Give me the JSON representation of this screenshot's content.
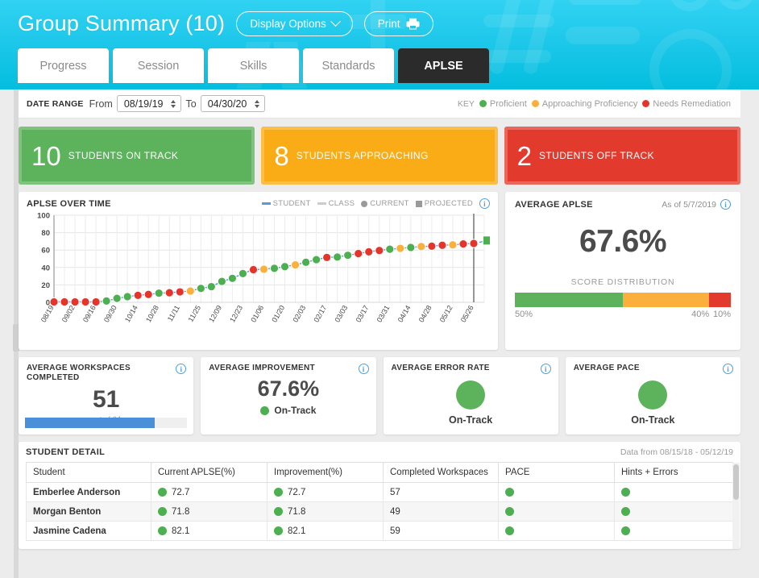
{
  "header": {
    "title": "Group Summary (10)",
    "display_options_label": "Display Options",
    "print_label": "Print",
    "tabs": [
      {
        "label": "Progress",
        "active": false
      },
      {
        "label": "Session",
        "active": false
      },
      {
        "label": "Skills",
        "active": false
      },
      {
        "label": "Standards",
        "active": false
      },
      {
        "label": "APLSE",
        "active": true
      }
    ]
  },
  "date_range": {
    "label": "DATE RANGE",
    "from_label": "From",
    "from_value": "08/19/19",
    "to_label": "To",
    "to_value": "04/30/20"
  },
  "key": {
    "label": "KEY",
    "items": [
      {
        "label": "Proficient",
        "color": "#4caf50"
      },
      {
        "label": "Approaching Proficiency",
        "color": "#fbb03b"
      },
      {
        "label": "Needs Remediation",
        "color": "#e5342a"
      }
    ]
  },
  "tiles": [
    {
      "value": "10",
      "caption": "STUDENTS ON TRACK",
      "color": "#5cb35c"
    },
    {
      "value": "8",
      "caption": "STUDENTS APPROACHING",
      "color": "#f9ac16"
    },
    {
      "value": "2",
      "caption": "STUDENTS OFF TRACK",
      "color": "#e23b2e"
    }
  ],
  "chart_card": {
    "title": "APLSE OVER TIME",
    "legend": [
      {
        "label": "STUDENT",
        "kind": "line",
        "color": "#5b9bd5"
      },
      {
        "label": "CLASS",
        "kind": "line",
        "color": "#cccccc"
      },
      {
        "label": "CURRENT",
        "kind": "circle",
        "color": "#9a9a9a"
      },
      {
        "label": "PROJECTED",
        "kind": "square",
        "color": "#9a9a9a"
      }
    ],
    "info_icon": "info-icon"
  },
  "average_aplse": {
    "title": "AVERAGE APLSE",
    "as_of": "As of 5/7/2019",
    "value": "67.6%",
    "distribution_label": "SCORE DISTRIBUTION",
    "distribution": [
      {
        "label": "50%",
        "pct": 50,
        "color": "#5cb35c"
      },
      {
        "label": "40%",
        "pct": 40,
        "color": "#fbb03b"
      },
      {
        "label": "10%",
        "pct": 10,
        "color": "#e23b2e"
      }
    ]
  },
  "metrics": [
    {
      "title": "AVERAGE WORKSPACES COMPLETED",
      "value": "51",
      "sub": "out of 64",
      "progress_pct": 80,
      "progress_color": "#4a90d9",
      "type": "progress"
    },
    {
      "title": "AVERAGE IMPROVEMENT",
      "value": "67.6%",
      "status": "On-Track",
      "status_color": "#4caf50",
      "type": "value-status"
    },
    {
      "title": "AVERAGE ERROR RATE",
      "status": "On-Track",
      "status_color": "#5cb35c",
      "type": "dot-status"
    },
    {
      "title": "AVERAGE PACE",
      "status": "On-Track",
      "status_color": "#5cb35c",
      "type": "dot-status"
    }
  ],
  "student_detail": {
    "title": "STUDENT DETAIL",
    "data_from": "Data from 08/15/18 - 05/12/19",
    "columns": [
      "Student",
      "Current APLSE(%)",
      "Improvement(%)",
      "Completed Workspaces",
      "PACE",
      "Hints + Errors"
    ],
    "rows": [
      {
        "student": "Emberlee Anderson",
        "current_aplse": "72.7",
        "current_color": "#4caf50",
        "improvement": "72.7",
        "improvement_color": "#4caf50",
        "workspaces": "57",
        "pace_color": "#4caf50",
        "hints_color": "#4caf50"
      },
      {
        "student": "Morgan Benton",
        "current_aplse": "71.8",
        "current_color": "#4caf50",
        "improvement": "71.8",
        "improvement_color": "#4caf50",
        "workspaces": "49",
        "pace_color": "#4caf50",
        "hints_color": "#4caf50"
      },
      {
        "student": "Jasmine Cadena",
        "current_aplse": "82.1",
        "current_color": "#4caf50",
        "improvement": "82.1",
        "improvement_color": "#4caf50",
        "workspaces": "59",
        "pace_color": "#4caf50",
        "hints_color": "#4caf50"
      }
    ]
  },
  "chart_data": {
    "type": "line",
    "title": "APLSE OVER TIME",
    "xlabel": "",
    "ylabel": "",
    "ylim": [
      0,
      100
    ],
    "yticks": [
      0,
      20,
      40,
      60,
      80,
      100
    ],
    "grid": true,
    "legend_position": "top-right",
    "categories": [
      "08/19",
      "09/02",
      "09/16",
      "09/30",
      "10/14",
      "10/28",
      "11/11",
      "11/25",
      "12/09",
      "12/23",
      "01/06",
      "01/20",
      "02/03",
      "02/17",
      "03/03",
      "03/17",
      "03/31",
      "04/14",
      "04/28",
      "05/12",
      "05/26"
    ],
    "x_tick_every": 2,
    "series": [
      {
        "name": "STUDENT",
        "color": "#5b9bd5",
        "values": [
          0.5,
          0.5,
          0.5,
          0.5,
          0.5,
          1.5,
          4.5,
          6.5,
          8,
          9,
          10.5,
          11,
          12,
          13,
          16,
          18,
          24,
          27.5,
          33,
          37.5,
          38,
          39,
          41,
          43,
          46,
          49,
          51.5,
          52,
          54,
          56,
          58,
          59.5,
          61,
          62,
          63,
          64,
          64.5,
          65.5,
          66,
          67,
          67.6
        ],
        "point_status": [
          "needs",
          "needs",
          "needs",
          "needs",
          "needs",
          "proficient",
          "proficient",
          "proficient",
          "needs",
          "needs",
          "proficient",
          "needs",
          "needs",
          "approaching",
          "proficient",
          "proficient",
          "proficient",
          "proficient",
          "proficient",
          "needs",
          "approaching",
          "proficient",
          "proficient",
          "approaching",
          "proficient",
          "proficient",
          "needs",
          "proficient",
          "proficient",
          "needs",
          "needs",
          "needs",
          "proficient",
          "approaching",
          "proficient",
          "approaching",
          "needs",
          "needs",
          "approaching",
          "needs",
          "needs"
        ]
      }
    ],
    "projected_point": {
      "value": 71,
      "color": "#4caf50",
      "marker": "square"
    },
    "current_marker_index": 40,
    "status_colors": {
      "proficient": "#4caf50",
      "approaching": "#fbb03b",
      "needs": "#e5342a"
    }
  }
}
